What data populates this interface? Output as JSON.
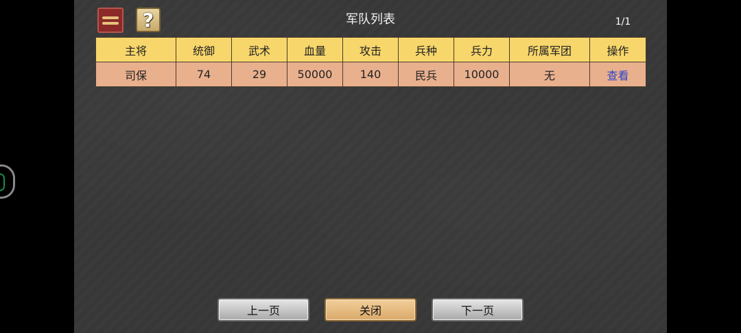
{
  "title": "军队列表",
  "page_indicator": "1/1",
  "side_widget_icon": "gauge-icon",
  "toolbar": {
    "menu_icon": "menu-icon",
    "help_glyph": "?"
  },
  "table": {
    "headers": [
      "主将",
      "统御",
      "武术",
      "血量",
      "攻击",
      "兵种",
      "兵力",
      "所属军团",
      "操作"
    ],
    "rows": [
      [
        "司保",
        "74",
        "29",
        "50000",
        "140",
        "民兵",
        "10000",
        "无",
        "查看"
      ]
    ]
  },
  "footer": {
    "prev_label": "上一页",
    "close_label": "关闭",
    "next_label": "下一页"
  },
  "colors": {
    "header_bg": "#f7d66b",
    "row_bg": "#e9b08e",
    "link": "#2a45c9",
    "panel_bg": "#383838"
  }
}
